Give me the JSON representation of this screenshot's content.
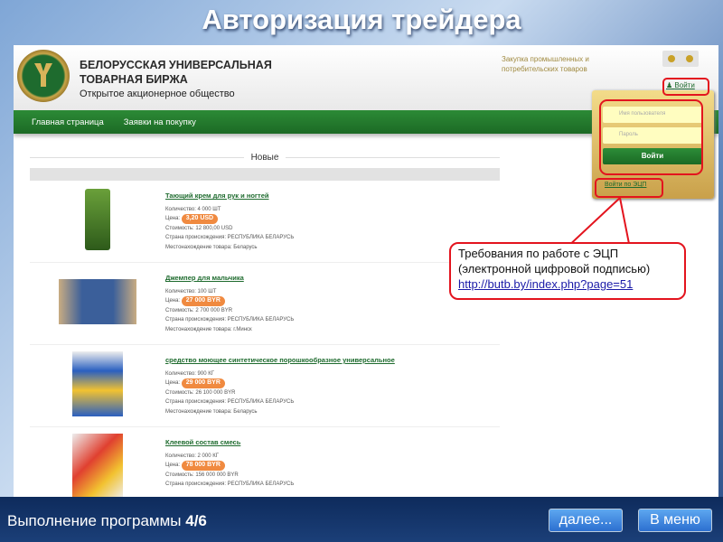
{
  "slide": {
    "title": "Авторизация трейдера",
    "progress_label": "Выполнение программы",
    "progress_value": "4/6",
    "next_button": "далее...",
    "menu_button": "В меню"
  },
  "site": {
    "brand_line1": "БЕЛОРУССКАЯ УНИВЕРСАЛЬНАЯ",
    "brand_line2": "ТОВАРНАЯ БИРЖА",
    "brand_sub": "Открытое акционерное общество",
    "header_text1": "Закупка промышленных и",
    "header_text2": "потребительских товаров",
    "login_link": "Войти",
    "nav": [
      "Главная страница",
      "Заявки на покупку"
    ],
    "section_title": "Новые",
    "items": [
      {
        "name": "Тающий крем для рук и ногтей",
        "qty": "Количество: 4 000 ШТ",
        "price_label": "Цена:",
        "price": "3,20 USD",
        "cost": "Стоимость: 12 800,00 USD",
        "country": "Страна происхождения: РЕСПУБЛИКА БЕЛАРУСЬ",
        "location": "Местонахождение товара: Беларусь"
      },
      {
        "name": "Джемпер для мальчика",
        "qty": "Количество: 100 ШТ",
        "price_label": "Цена:",
        "price": "27 000 BYR",
        "cost": "Стоимость: 2 700 000 BYR",
        "country": "Страна происхождения: РЕСПУБЛИКА БЕЛАРУСЬ",
        "location": "Местонахождение товара: г.Минск"
      },
      {
        "name": "средство моющее синтетическое порошкообразное универсальное",
        "qty": "Количество: 900 КГ",
        "price_label": "Цена:",
        "price": "29 000 BYR",
        "cost": "Стоимость: 26 100 000 BYR",
        "country": "Страна происхождения: РЕСПУБЛИКА БЕЛАРУСЬ",
        "location": "Местонахождение товара: Беларусь"
      },
      {
        "name": "Клеевой состав смесь",
        "qty": "Количество: 2 000 КГ",
        "price_label": "Цена:",
        "price": "78 000 BYR",
        "cost": "Стоимость: 156 000 000 BYR",
        "country": "Страна происхождения: РЕСПУБЛИКА БЕЛАРУСЬ",
        "location": ""
      }
    ]
  },
  "login": {
    "username_placeholder": "Имя пользователя",
    "password_placeholder": "Пароль",
    "submit": "Войти",
    "ecp_link": "Войти по ЭЦП"
  },
  "callout": {
    "text": "Требования по работе с ЭЦП (электронной цифровой подписью)",
    "url": "http://butb.by/index.php?page=51"
  }
}
